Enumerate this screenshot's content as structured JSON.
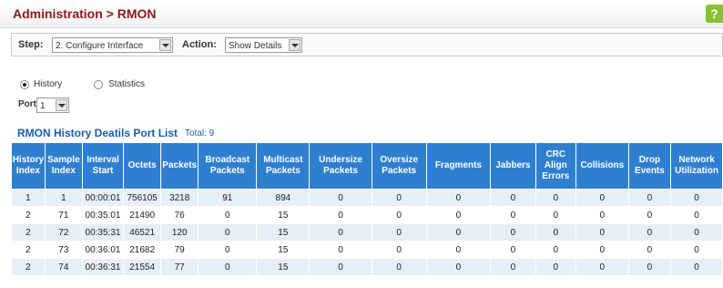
{
  "header": {
    "title": "Administration > RMON",
    "help_icon_glyph": "?"
  },
  "toolbar": {
    "step_label": "Step:",
    "step_value": "2. Configure Interface",
    "action_label": "Action:",
    "action_value": "Show Details"
  },
  "mode": {
    "history_label": "History",
    "statistics_label": "Statistics",
    "selected": "History"
  },
  "port": {
    "label": "Port",
    "value": "1"
  },
  "list": {
    "title": "RMON History Deatils Port List",
    "total": "Total: 9",
    "columns": [
      "History Index",
      "Sample Index",
      "Interval Start",
      "Octets",
      "Packets",
      "Broadcast Packets",
      "Multicast Packets",
      "Undersize Packets",
      "Oversize Packets",
      "Fragments",
      "Jabbers",
      "CRC Align Errors",
      "Collisions",
      "Drop Events",
      "Network Utilization"
    ],
    "rows": [
      [
        "1",
        "1",
        "00:00:01",
        "756105",
        "3218",
        "91",
        "894",
        "0",
        "0",
        "0",
        "0",
        "0",
        "0",
        "0",
        "0"
      ],
      [
        "2",
        "71",
        "00:35:01",
        "21490",
        "76",
        "0",
        "15",
        "0",
        "0",
        "0",
        "0",
        "0",
        "0",
        "0",
        "0"
      ],
      [
        "2",
        "72",
        "00:35:31",
        "46521",
        "120",
        "0",
        "15",
        "0",
        "0",
        "0",
        "0",
        "0",
        "0",
        "0",
        "0"
      ],
      [
        "2",
        "73",
        "00:36:01",
        "21682",
        "79",
        "0",
        "15",
        "0",
        "0",
        "0",
        "0",
        "0",
        "0",
        "0",
        "0"
      ],
      [
        "2",
        "74",
        "00:36:31",
        "21554",
        "77",
        "0",
        "15",
        "0",
        "0",
        "0",
        "0",
        "0",
        "0",
        "0",
        "0"
      ]
    ]
  },
  "colors": {
    "accent": "#2f7fd0",
    "title": "#8b1a1a",
    "help": "#86c232"
  }
}
